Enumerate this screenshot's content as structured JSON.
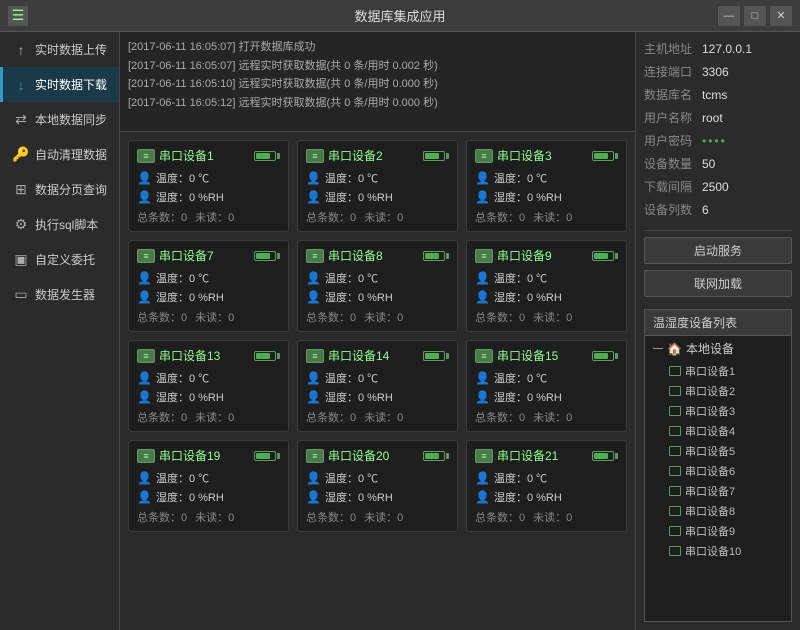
{
  "titlebar": {
    "title": "数据库集成应用",
    "icon": "☰",
    "minimize": "—",
    "maximize": "□",
    "close": "✕"
  },
  "sidebar": {
    "items": [
      {
        "id": "upload",
        "label": "实时数据上传",
        "icon": "↑",
        "active": false
      },
      {
        "id": "download",
        "label": "实时数据下载",
        "icon": "↓",
        "active": true
      },
      {
        "id": "sync",
        "label": "本地数据同步",
        "icon": "⇄",
        "active": false
      },
      {
        "id": "manage",
        "label": "自动清理数据",
        "icon": "🔑",
        "active": false
      },
      {
        "id": "query",
        "label": "数据分页查询",
        "icon": "⊞",
        "active": false
      },
      {
        "id": "sql",
        "label": "执行sql脚本",
        "icon": "⚙",
        "active": false
      },
      {
        "id": "delegate",
        "label": "自定义委托",
        "icon": "▣",
        "active": false
      },
      {
        "id": "generator",
        "label": "数据发生器",
        "icon": "▭",
        "active": false
      }
    ]
  },
  "log": {
    "entries": [
      "[2017-06-11 16:05:07] 打开数据库成功",
      "[2017-06-11 16:05:07] 远程实时获取数据(共 0 条/用时 0.002 秒)",
      "[2017-06-11 16:05:10] 远程实时获取数据(共 0 条/用时 0.000 秒)",
      "[2017-06-11 16:05:12] 远程实时获取数据(共 0 条/用时 0.000 秒)"
    ]
  },
  "devices": [
    {
      "id": 1,
      "name": "串口设备1",
      "temp": "温度：0 ℃",
      "humidity": "湿度：0 %RH",
      "total": "0",
      "unread": "0"
    },
    {
      "id": 2,
      "name": "串口设备2",
      "temp": "温度：0 ℃",
      "humidity": "湿度：0 %RH",
      "total": "0",
      "unread": "0"
    },
    {
      "id": 3,
      "name": "串口设备3",
      "temp": "温度：0 ℃",
      "humidity": "湿度：0 %RH",
      "total": "0",
      "unread": "0"
    },
    {
      "id": 7,
      "name": "串口设备7",
      "temp": "温度：0 ℃",
      "humidity": "湿度：0 %RH",
      "total": "0",
      "unread": "0"
    },
    {
      "id": 8,
      "name": "串口设备8",
      "temp": "温度：0 ℃",
      "humidity": "湿度：0 %RH",
      "total": "0",
      "unread": "0"
    },
    {
      "id": 9,
      "name": "串口设备9",
      "temp": "温度：0 ℃",
      "humidity": "湿度：0 %RH",
      "total": "0",
      "unread": "0"
    },
    {
      "id": 13,
      "name": "串口设备13",
      "temp": "温度：0 ℃",
      "humidity": "湿度：0 %RH",
      "total": "0",
      "unread": "0"
    },
    {
      "id": 14,
      "name": "串口设备14",
      "temp": "温度：0 ℃",
      "humidity": "湿度：0 %RH",
      "total": "0",
      "unread": "0"
    },
    {
      "id": 15,
      "name": "串口设备15",
      "temp": "温度：0 ℃",
      "humidity": "湿度：0 %RH",
      "total": "0",
      "unread": "0"
    },
    {
      "id": 19,
      "name": "串口设备19",
      "temp": "温度：0 ℃",
      "humidity": "湿度：0 %RH",
      "total": "0",
      "unread": "0"
    },
    {
      "id": 20,
      "name": "串口设备20",
      "temp": "温度：0 ℃",
      "humidity": "湿度：0 %RH",
      "total": "0",
      "unread": "0"
    },
    {
      "id": 21,
      "name": "串口设备21",
      "temp": "温度：0 ℃",
      "humidity": "湿度：0 %RH",
      "total": "0",
      "unread": "0"
    }
  ],
  "info": {
    "host_label": "主机地址",
    "host_value": "127.0.0.1",
    "port_label": "连接端口",
    "port_value": "3306",
    "dbname_label": "数据库名",
    "dbname_value": "tcms",
    "user_label": "用户名称",
    "user_value": "root",
    "password_label": "用户密码",
    "password_value": "••••",
    "devices_label": "设备数量",
    "devices_value": "50",
    "interval_label": "下载间隔",
    "interval_value": "2500",
    "columns_label": "设备列数",
    "columns_value": "6",
    "start_btn": "启动服务",
    "network_btn": "联网加载",
    "device_list_title": "温湿度设备列表",
    "local_devices_label": "本地设备",
    "device_list": [
      "串口设备1",
      "串口设备2",
      "串口设备3",
      "串口设备4",
      "串口设备5",
      "串口设备6",
      "串口设备7",
      "串口设备8",
      "串口设备9",
      "串口设备10"
    ]
  },
  "labels": {
    "total": "总条数：",
    "unread": "未读：",
    "total_label": "总条数：",
    "unread_label": "未读："
  }
}
